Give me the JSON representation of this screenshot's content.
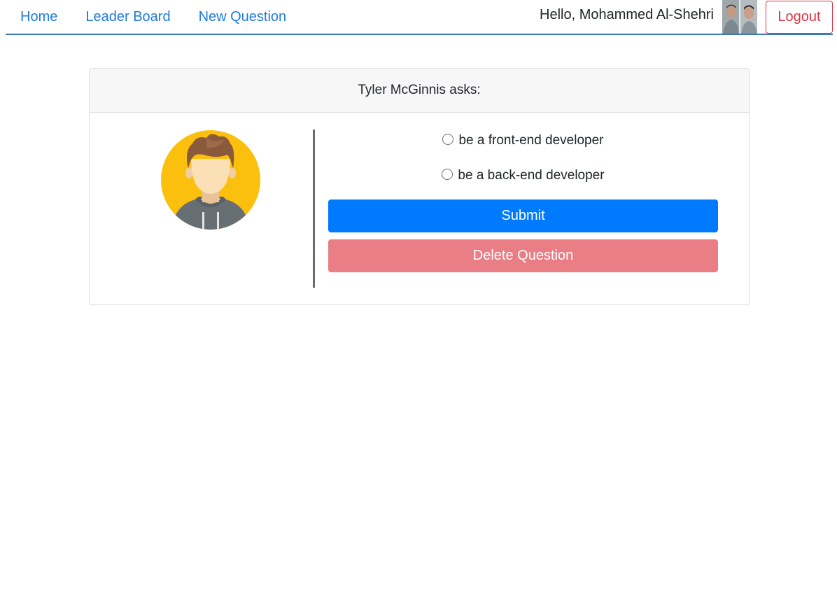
{
  "nav": {
    "links": [
      "Home",
      "Leader Board",
      "New Question"
    ],
    "greeting": "Hello, Mohammed Al-Shehri",
    "logout_label": "Logout",
    "link_color": "#1e7be0",
    "logout_color": "#dc3545"
  },
  "question": {
    "header": "Tyler McGinnis asks:",
    "options": [
      "be a front-end developer",
      "be a back-end developer"
    ],
    "submit_label": "Submit",
    "delete_label": "Delete Question",
    "submit_color": "#007bff",
    "delete_color": "#e97e86"
  }
}
